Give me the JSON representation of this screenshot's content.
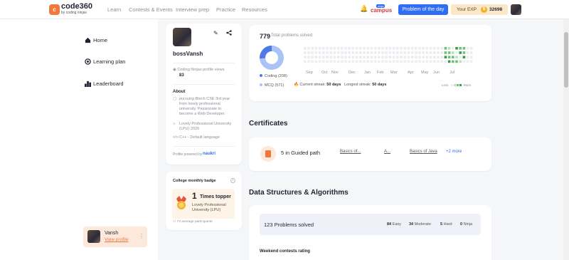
{
  "brand": {
    "badge": "c",
    "name": "code360",
    "sub": "by coding ninjas"
  },
  "nav": {
    "links": [
      "Learn",
      "Contests & Events",
      "Interview prep",
      "Practice",
      "Resources"
    ],
    "campus_tag": "ninja",
    "campus_label": "campus",
    "potd": "Problem of the day",
    "exp_label": "Your EXP",
    "exp_value": "32698"
  },
  "sidebar": {
    "items": [
      {
        "label": "Home",
        "icon": "home-icon"
      },
      {
        "label": "Learning plan",
        "icon": "target-icon"
      },
      {
        "label": "Leaderboard",
        "icon": "leaderboard-icon"
      }
    ],
    "user_name": "Vansh",
    "user_link": "View profile"
  },
  "profile": {
    "name": "bossVansh",
    "views_label": "Coding Ninjas profile views",
    "views": "83",
    "about_heading": "About",
    "about_text": "pursuing Btech CSE 3rd year from lovely professional university. Passionate to become a Web Developer.",
    "university": "Lovely Professional University (LPU) 2026",
    "language": "C++ - Default language",
    "powered_by": "Profile powered by",
    "powered_brand": "naukri"
  },
  "badge": {
    "heading": "College monthly badge",
    "count": "1",
    "label": "Times topper",
    "college": "Lovely Professional University (LPU)",
    "participants": "73 average participants"
  },
  "stats": {
    "total": "779",
    "total_label": "Total problems solved",
    "coding_label": "Coding (208)",
    "mcq_label": "MCQ (571)",
    "coding_count": 208,
    "mcq_count": 571,
    "coding_color": "#4f78e8",
    "mcq_color": "#a9c3f5",
    "months": [
      "Sep",
      "Oct",
      "Nov",
      "Dec",
      "Jan",
      "Feb",
      "Mar",
      "Apr",
      "May",
      "Jun",
      "Jul"
    ],
    "current_streak_label": "Current streak:",
    "current_streak": "50 days",
    "longest_streak_label": "Longest streak:",
    "longest_streak": "50 days",
    "less": "Less",
    "more": "More"
  },
  "certificates": {
    "heading": "Certificates",
    "count_text": "5 in Guided path",
    "links": [
      "Basics of...",
      "A...",
      "Basics of Java"
    ],
    "more": "+2 more"
  },
  "dsa": {
    "heading": "Data Structures & Algorithms",
    "solved": "123 Problems solved",
    "easy_count": "84",
    "easy_label": "Easy",
    "moderate_count": "34",
    "moderate_label": "Moderate",
    "hard_count": "5",
    "hard_label": "Hard",
    "ninja_count": "0",
    "ninja_label": "Ninja",
    "weekend": "Weekend contests rating"
  },
  "colors": {
    "accent": "#f0783c",
    "primary": "#2f6df6",
    "heat_green": "#3c9a4a"
  }
}
